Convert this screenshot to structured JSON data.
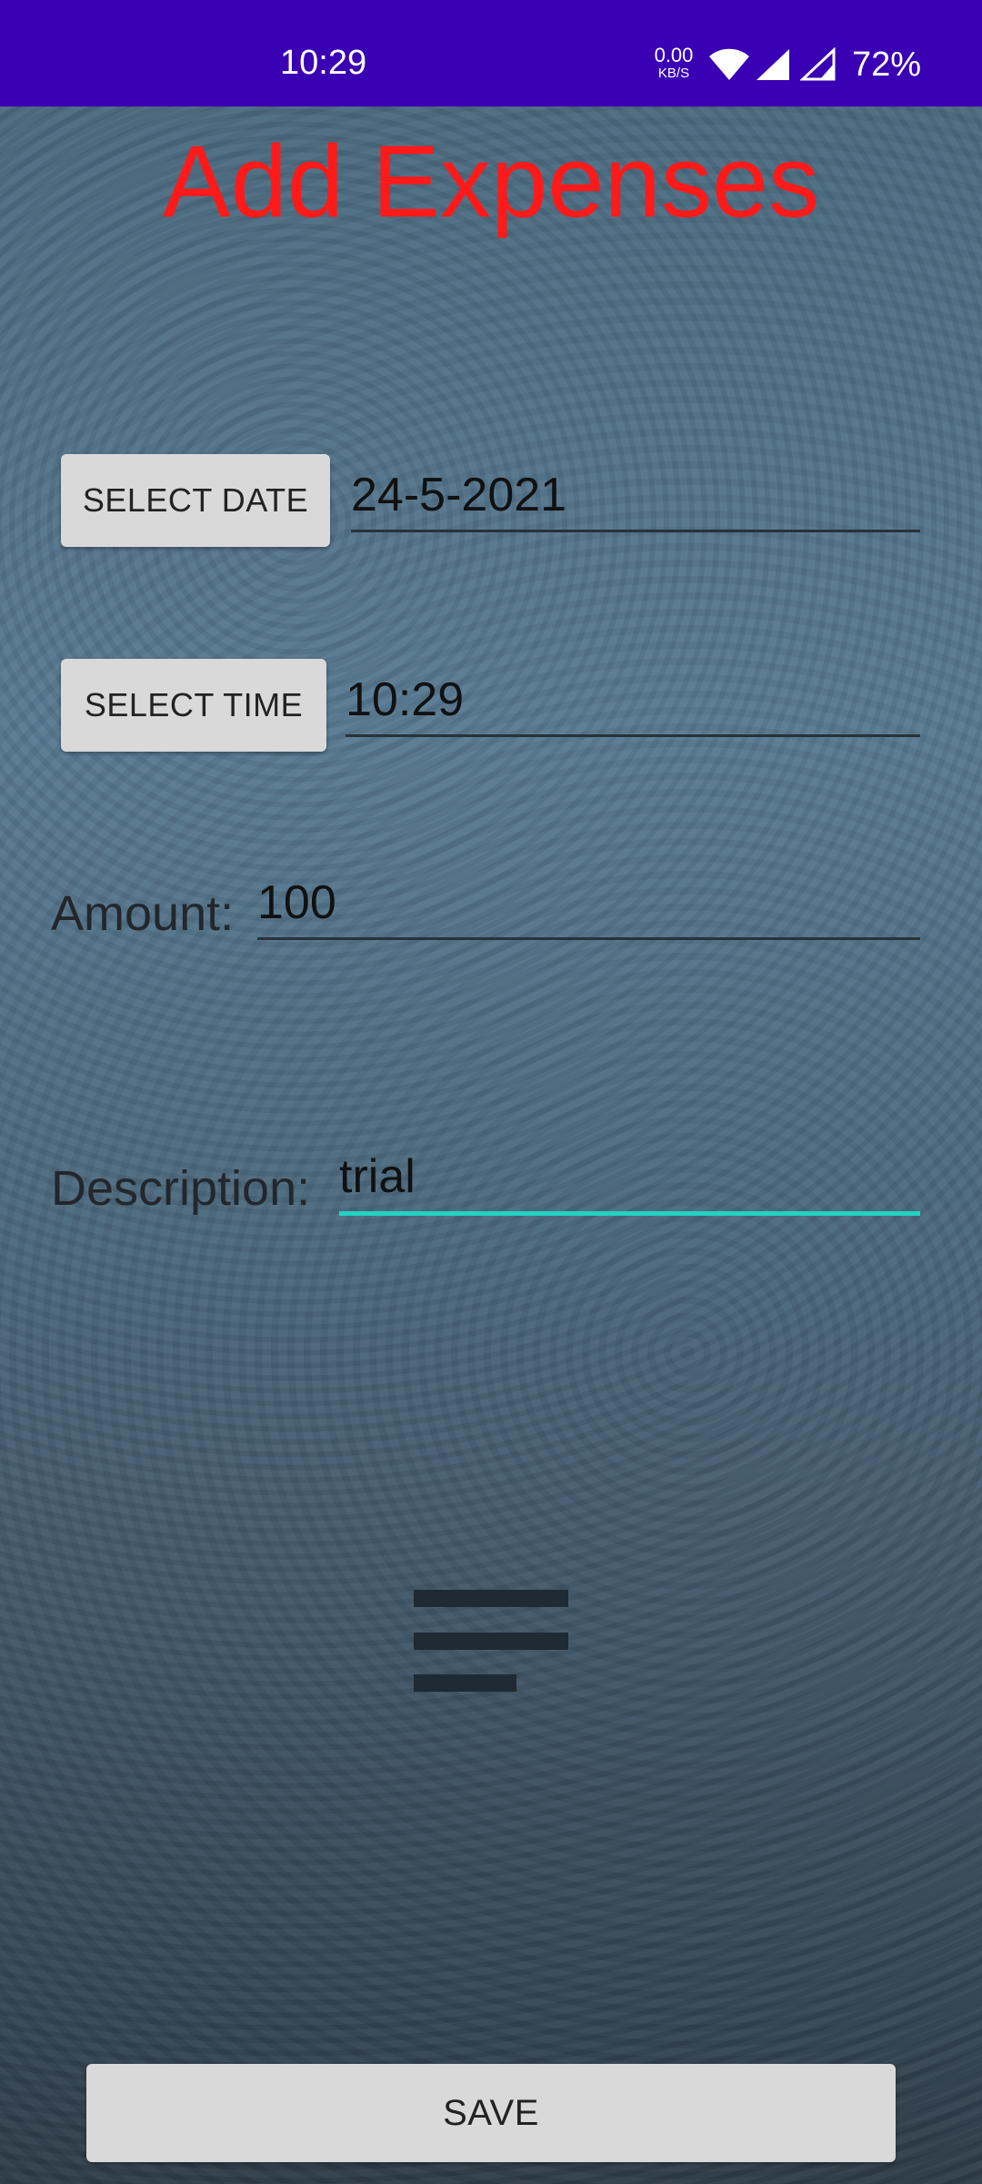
{
  "status_bar": {
    "time": "10:29",
    "net_speed_value": "0.00",
    "net_speed_unit": "KB/S",
    "battery": "72%",
    "icons": [
      "wifi-icon",
      "signal-icon",
      "signal-icon"
    ],
    "background_color": "#3a00b3"
  },
  "page": {
    "title": "Add Expenses",
    "title_color": "#ff1a1a"
  },
  "form": {
    "select_date_label": "SELECT DATE",
    "date_value": "24-5-2021",
    "select_time_label": "SELECT TIME",
    "time_value": "10:29",
    "amount_label": "Amount:",
    "amount_value": "100",
    "description_label": "Description:",
    "description_value": "trial",
    "focused_field": "description",
    "accent_color": "#20d3c2"
  },
  "menu_icon": "menu-icon",
  "save_label": "SAVE"
}
